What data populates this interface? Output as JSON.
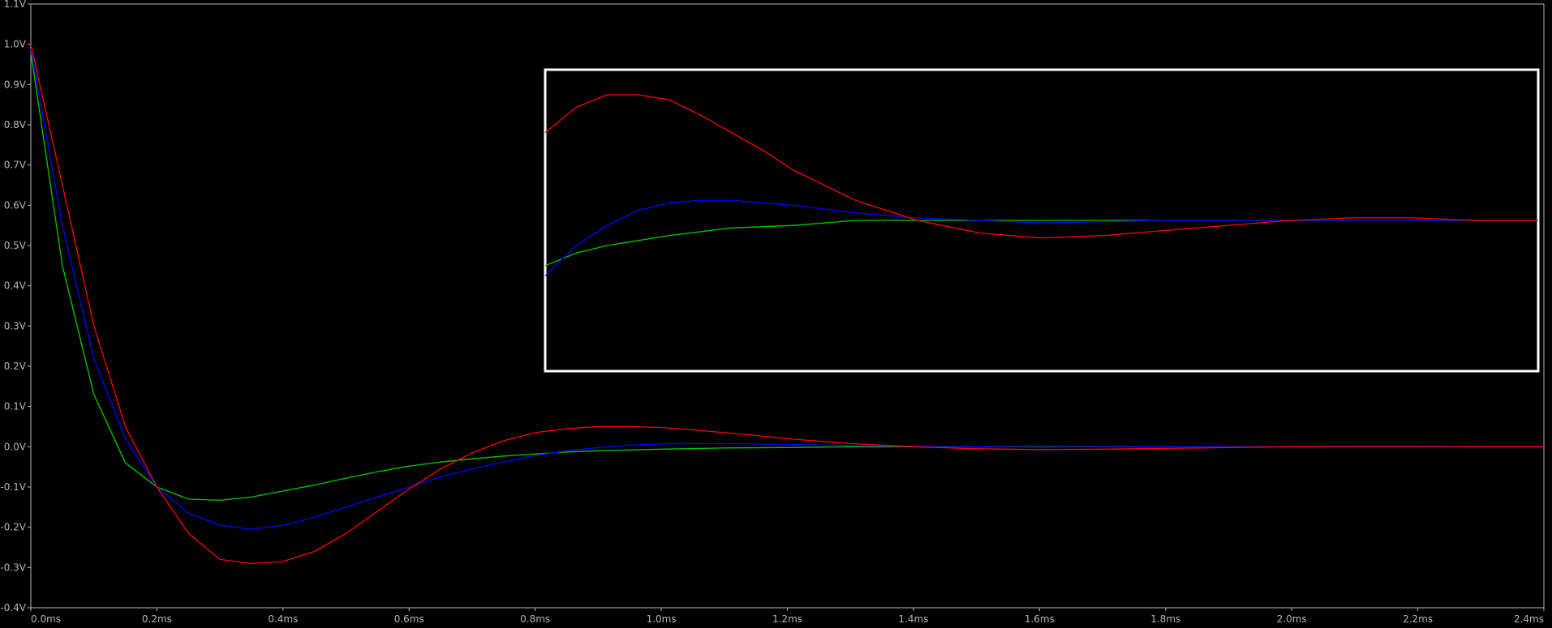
{
  "chart_data": {
    "type": "line",
    "title": "",
    "xlabel": "",
    "ylabel": "",
    "xlim": [
      0,
      2.4
    ],
    "ylim": [
      -0.4,
      1.1
    ],
    "x_unit": "ms",
    "y_unit": "V",
    "x_ticks": [
      "0.0ms",
      "0.2ms",
      "0.4ms",
      "0.6ms",
      "0.8ms",
      "1.0ms",
      "1.2ms",
      "1.4ms",
      "1.6ms",
      "1.8ms",
      "2.0ms",
      "2.2ms",
      "2.4ms"
    ],
    "y_ticks": [
      "1.1V",
      "1.0V",
      "0.9V",
      "0.8V",
      "0.7V",
      "0.6V",
      "0.5V",
      "0.4V",
      "0.3V",
      "0.2V",
      "0.1V",
      "0.0V",
      "-0.1V",
      "-0.2V",
      "-0.3V",
      "-0.4V"
    ],
    "grid": false,
    "background": "#000000",
    "axis_color": "#b4b4b4",
    "series": [
      {
        "color": "#00c800",
        "x": [
          0.0,
          0.05,
          0.1,
          0.15,
          0.2,
          0.25,
          0.3,
          0.35,
          0.4,
          0.45,
          0.5,
          0.55,
          0.6,
          0.65,
          0.7,
          0.75,
          0.8,
          0.85,
          0.9,
          1.0,
          1.1,
          1.2,
          1.3,
          1.4,
          1.5,
          1.6,
          1.8,
          2.0,
          2.2,
          2.4
        ],
        "y": [
          0.98,
          0.45,
          0.13,
          -0.04,
          -0.1,
          -0.13,
          -0.133,
          -0.125,
          -0.11,
          -0.095,
          -0.078,
          -0.062,
          -0.048,
          -0.038,
          -0.03,
          -0.023,
          -0.018,
          -0.013,
          -0.01,
          -0.006,
          -0.003,
          -0.002,
          0.0,
          0.0,
          0.0,
          0.0,
          0.0,
          0.0,
          0.0,
          0.0
        ]
      },
      {
        "color": "#0000ff",
        "x": [
          0.0,
          0.05,
          0.1,
          0.15,
          0.2,
          0.25,
          0.3,
          0.35,
          0.4,
          0.45,
          0.5,
          0.55,
          0.6,
          0.65,
          0.7,
          0.75,
          0.8,
          0.85,
          0.9,
          0.95,
          1.0,
          1.05,
          1.1,
          1.2,
          1.3,
          1.4,
          1.5,
          1.6,
          1.8,
          2.0,
          2.2,
          2.4
        ],
        "y": [
          0.99,
          0.55,
          0.22,
          0.02,
          -0.1,
          -0.165,
          -0.195,
          -0.205,
          -0.195,
          -0.175,
          -0.15,
          -0.125,
          -0.1,
          -0.075,
          -0.055,
          -0.038,
          -0.022,
          -0.01,
          -0.002,
          0.004,
          0.007,
          0.008,
          0.008,
          0.006,
          0.003,
          0.001,
          0.0,
          -0.001,
          0.0,
          0.0,
          0.0,
          0.0
        ]
      },
      {
        "color": "#ff0000",
        "x": [
          0.0,
          0.05,
          0.1,
          0.15,
          0.2,
          0.25,
          0.3,
          0.35,
          0.4,
          0.45,
          0.5,
          0.55,
          0.6,
          0.65,
          0.7,
          0.75,
          0.8,
          0.85,
          0.9,
          0.95,
          1.0,
          1.05,
          1.1,
          1.15,
          1.2,
          1.3,
          1.4,
          1.5,
          1.6,
          1.7,
          1.8,
          1.9,
          2.0,
          2.1,
          2.2,
          2.3,
          2.4
        ],
        "y": [
          1.0,
          0.65,
          0.3,
          0.05,
          -0.1,
          -0.215,
          -0.28,
          -0.29,
          -0.285,
          -0.26,
          -0.215,
          -0.16,
          -0.105,
          -0.055,
          -0.015,
          0.015,
          0.035,
          0.045,
          0.05,
          0.05,
          0.048,
          0.042,
          0.035,
          0.028,
          0.02,
          0.008,
          0.0,
          -0.005,
          -0.007,
          -0.006,
          -0.004,
          -0.002,
          0.0,
          0.001,
          0.001,
          0.0,
          0.0
        ]
      }
    ],
    "inset": {
      "border_color": "#ffffff"
    }
  }
}
